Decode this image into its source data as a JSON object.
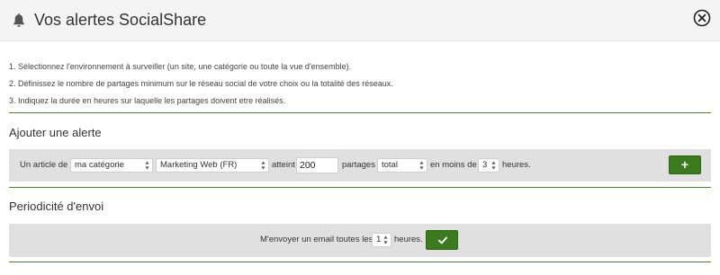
{
  "header": {
    "title": "Vos alertes SocialShare",
    "bell_icon": "bell-icon",
    "close_icon": "close-circle-icon"
  },
  "instructions": [
    "1. Sélectionnez l'environnement à surveiller (un site, une catégorie ou toute la vue d'ensemble).",
    "2. Définissez le nombre de partages minimum sur le réseau social de votre choix ou la totalité des réseaux.",
    "3. Indiquez la durée en heures sur laquelle les partages doivent etre réalisés."
  ],
  "add_alert": {
    "section_title": "Ajouter une alerte",
    "prefix_label": "Un article de",
    "category_select": "ma catégorie",
    "site_select": "Marketing Web (FR)",
    "reaches_label": "atteint",
    "shares_value": "200",
    "shares_label": "partages",
    "network_select": "total",
    "within_label": "en moins de",
    "hours_select": "3",
    "hours_label": "heures.",
    "add_button": "+"
  },
  "frequency": {
    "section_title": "Periodicité d'envoi",
    "prefix_label": "M'envoyer un email toutes les",
    "hours_select": "1",
    "hours_label": "heures.",
    "confirm_icon": "check-icon"
  },
  "colors": {
    "accent_green": "#3b7a1e",
    "rule_green": "#3f8a2a",
    "header_bg": "#f4f4f4",
    "row_bg": "#e0e0e0"
  }
}
